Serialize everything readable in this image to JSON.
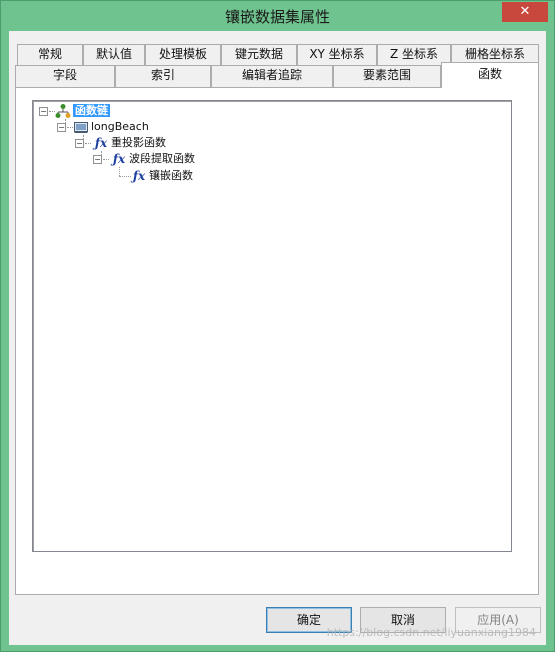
{
  "window": {
    "title": "镶嵌数据集属性",
    "close_label": "✕"
  },
  "tabs": {
    "row1": [
      "常规",
      "默认值",
      "处理模板",
      "键元数据",
      "XY 坐标系",
      "Z 坐标系",
      "栅格坐标系"
    ],
    "row2": [
      "字段",
      "索引",
      "编辑者追踪",
      "要素范围",
      "函数"
    ],
    "active": "函数"
  },
  "tree": {
    "root": "函数链",
    "child1": "longBeach",
    "child2": "重投影函数",
    "child3": "波段提取函数",
    "child4": "镶嵌函数"
  },
  "buttons": {
    "ok": "确定",
    "cancel": "取消",
    "apply": "应用(A)"
  },
  "watermark": "https://blog.csdn.net/liyuanxiang1984",
  "colors": {
    "frame": "#6fc38e",
    "selection": "#3399ff",
    "close": "#c9483d"
  }
}
